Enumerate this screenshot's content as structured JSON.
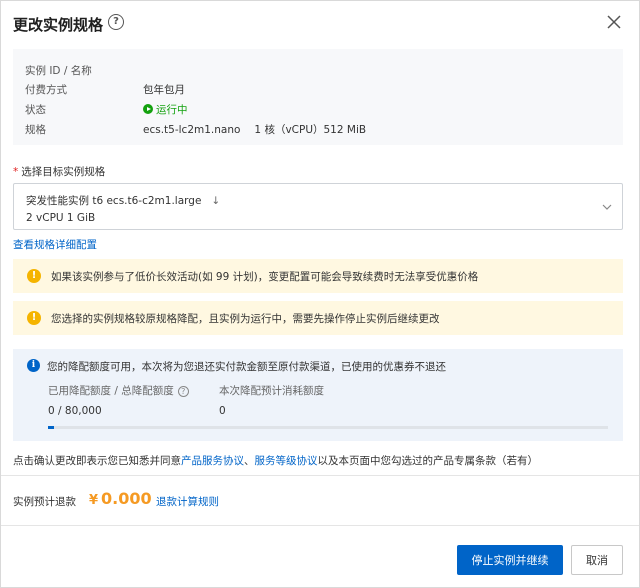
{
  "dialog": {
    "title": "更改实例规格",
    "help_icon_glyph": "?",
    "close_icon": "close-icon"
  },
  "instance_info": {
    "rows": [
      {
        "label": "实例 ID / 名称",
        "value": ""
      },
      {
        "label": "付费方式",
        "value": "包年包月"
      },
      {
        "label": "状态",
        "value": "运行中"
      },
      {
        "label": "规格",
        "value": "ecs.t5-lc2m1.nano",
        "extra": "1 核（vCPU）512 MiB"
      }
    ],
    "status_color": "#13a10e"
  },
  "target_spec": {
    "label": "选择目标实例规格",
    "required_mark": "*",
    "line1": "突发性能实例 t6   ecs.t6-c2m1.large",
    "line2": "2 vCPU   1 GiB",
    "down_arrow": "↓",
    "detail_link": "查看规格详细配置"
  },
  "warnings": [
    {
      "icon": "!",
      "text": "如果该实例参与了低价长效活动(如 99 计划)，变更配置可能会导致续费时无法享受优惠价格"
    },
    {
      "icon": "!",
      "text": "您选择的实例规格较原规格降配，且实例为运行中，需要先操作停止实例后继续更改"
    }
  ],
  "refund_info": {
    "icon": "i",
    "message": "您的降配额度可用，本次将为您退还实付款金额至原付款渠道，已使用的优惠券不退还",
    "quota_label": "已用降配额度 / 总降配额度",
    "quota_help": "?",
    "quota_value": "0 / 80,000",
    "quota_used_fraction": 0.01,
    "consume_label": "本次降配预计消耗额度",
    "consume_value": "0"
  },
  "agreement": {
    "prefix": "点击确认更改即表示您已知悉并同意",
    "link1": "产品服务协议",
    "sep": "、",
    "link2": "服务等级协议",
    "suffix": "以及本页面中您勾选过的产品专属条款（若有）"
  },
  "refund_estimate": {
    "label": "实例预计退款",
    "currency": "¥",
    "amount": "0.000",
    "rule_link": "退款计算规则"
  },
  "buttons": {
    "primary": "停止实例并继续",
    "cancel": "取消"
  },
  "colors": {
    "accent": "#0064c8",
    "warning_bg": "#fff8e1",
    "warning_icon": "#f5b400",
    "info_bg": "#eef3fa",
    "amount": "#f59a23"
  }
}
